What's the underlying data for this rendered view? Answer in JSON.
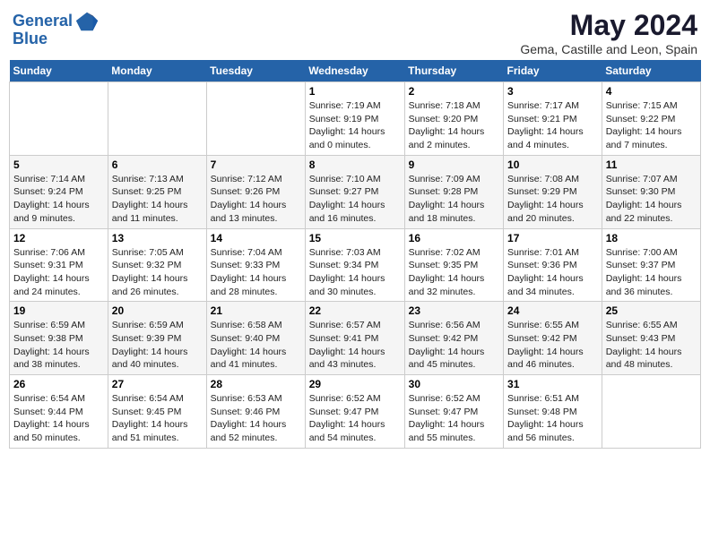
{
  "header": {
    "logo_line1": "General",
    "logo_line2": "Blue",
    "title": "May 2024",
    "subtitle": "Gema, Castille and Leon, Spain"
  },
  "days_of_week": [
    "Sunday",
    "Monday",
    "Tuesday",
    "Wednesday",
    "Thursday",
    "Friday",
    "Saturday"
  ],
  "weeks": [
    [
      {
        "day": "",
        "sunrise": "",
        "sunset": "",
        "daylight": ""
      },
      {
        "day": "",
        "sunrise": "",
        "sunset": "",
        "daylight": ""
      },
      {
        "day": "",
        "sunrise": "",
        "sunset": "",
        "daylight": ""
      },
      {
        "day": "1",
        "sunrise": "Sunrise: 7:19 AM",
        "sunset": "Sunset: 9:19 PM",
        "daylight": "Daylight: 14 hours and 0 minutes."
      },
      {
        "day": "2",
        "sunrise": "Sunrise: 7:18 AM",
        "sunset": "Sunset: 9:20 PM",
        "daylight": "Daylight: 14 hours and 2 minutes."
      },
      {
        "day": "3",
        "sunrise": "Sunrise: 7:17 AM",
        "sunset": "Sunset: 9:21 PM",
        "daylight": "Daylight: 14 hours and 4 minutes."
      },
      {
        "day": "4",
        "sunrise": "Sunrise: 7:15 AM",
        "sunset": "Sunset: 9:22 PM",
        "daylight": "Daylight: 14 hours and 7 minutes."
      }
    ],
    [
      {
        "day": "5",
        "sunrise": "Sunrise: 7:14 AM",
        "sunset": "Sunset: 9:24 PM",
        "daylight": "Daylight: 14 hours and 9 minutes."
      },
      {
        "day": "6",
        "sunrise": "Sunrise: 7:13 AM",
        "sunset": "Sunset: 9:25 PM",
        "daylight": "Daylight: 14 hours and 11 minutes."
      },
      {
        "day": "7",
        "sunrise": "Sunrise: 7:12 AM",
        "sunset": "Sunset: 9:26 PM",
        "daylight": "Daylight: 14 hours and 13 minutes."
      },
      {
        "day": "8",
        "sunrise": "Sunrise: 7:10 AM",
        "sunset": "Sunset: 9:27 PM",
        "daylight": "Daylight: 14 hours and 16 minutes."
      },
      {
        "day": "9",
        "sunrise": "Sunrise: 7:09 AM",
        "sunset": "Sunset: 9:28 PM",
        "daylight": "Daylight: 14 hours and 18 minutes."
      },
      {
        "day": "10",
        "sunrise": "Sunrise: 7:08 AM",
        "sunset": "Sunset: 9:29 PM",
        "daylight": "Daylight: 14 hours and 20 minutes."
      },
      {
        "day": "11",
        "sunrise": "Sunrise: 7:07 AM",
        "sunset": "Sunset: 9:30 PM",
        "daylight": "Daylight: 14 hours and 22 minutes."
      }
    ],
    [
      {
        "day": "12",
        "sunrise": "Sunrise: 7:06 AM",
        "sunset": "Sunset: 9:31 PM",
        "daylight": "Daylight: 14 hours and 24 minutes."
      },
      {
        "day": "13",
        "sunrise": "Sunrise: 7:05 AM",
        "sunset": "Sunset: 9:32 PM",
        "daylight": "Daylight: 14 hours and 26 minutes."
      },
      {
        "day": "14",
        "sunrise": "Sunrise: 7:04 AM",
        "sunset": "Sunset: 9:33 PM",
        "daylight": "Daylight: 14 hours and 28 minutes."
      },
      {
        "day": "15",
        "sunrise": "Sunrise: 7:03 AM",
        "sunset": "Sunset: 9:34 PM",
        "daylight": "Daylight: 14 hours and 30 minutes."
      },
      {
        "day": "16",
        "sunrise": "Sunrise: 7:02 AM",
        "sunset": "Sunset: 9:35 PM",
        "daylight": "Daylight: 14 hours and 32 minutes."
      },
      {
        "day": "17",
        "sunrise": "Sunrise: 7:01 AM",
        "sunset": "Sunset: 9:36 PM",
        "daylight": "Daylight: 14 hours and 34 minutes."
      },
      {
        "day": "18",
        "sunrise": "Sunrise: 7:00 AM",
        "sunset": "Sunset: 9:37 PM",
        "daylight": "Daylight: 14 hours and 36 minutes."
      }
    ],
    [
      {
        "day": "19",
        "sunrise": "Sunrise: 6:59 AM",
        "sunset": "Sunset: 9:38 PM",
        "daylight": "Daylight: 14 hours and 38 minutes."
      },
      {
        "day": "20",
        "sunrise": "Sunrise: 6:59 AM",
        "sunset": "Sunset: 9:39 PM",
        "daylight": "Daylight: 14 hours and 40 minutes."
      },
      {
        "day": "21",
        "sunrise": "Sunrise: 6:58 AM",
        "sunset": "Sunset: 9:40 PM",
        "daylight": "Daylight: 14 hours and 41 minutes."
      },
      {
        "day": "22",
        "sunrise": "Sunrise: 6:57 AM",
        "sunset": "Sunset: 9:41 PM",
        "daylight": "Daylight: 14 hours and 43 minutes."
      },
      {
        "day": "23",
        "sunrise": "Sunrise: 6:56 AM",
        "sunset": "Sunset: 9:42 PM",
        "daylight": "Daylight: 14 hours and 45 minutes."
      },
      {
        "day": "24",
        "sunrise": "Sunrise: 6:55 AM",
        "sunset": "Sunset: 9:42 PM",
        "daylight": "Daylight: 14 hours and 46 minutes."
      },
      {
        "day": "25",
        "sunrise": "Sunrise: 6:55 AM",
        "sunset": "Sunset: 9:43 PM",
        "daylight": "Daylight: 14 hours and 48 minutes."
      }
    ],
    [
      {
        "day": "26",
        "sunrise": "Sunrise: 6:54 AM",
        "sunset": "Sunset: 9:44 PM",
        "daylight": "Daylight: 14 hours and 50 minutes."
      },
      {
        "day": "27",
        "sunrise": "Sunrise: 6:54 AM",
        "sunset": "Sunset: 9:45 PM",
        "daylight": "Daylight: 14 hours and 51 minutes."
      },
      {
        "day": "28",
        "sunrise": "Sunrise: 6:53 AM",
        "sunset": "Sunset: 9:46 PM",
        "daylight": "Daylight: 14 hours and 52 minutes."
      },
      {
        "day": "29",
        "sunrise": "Sunrise: 6:52 AM",
        "sunset": "Sunset: 9:47 PM",
        "daylight": "Daylight: 14 hours and 54 minutes."
      },
      {
        "day": "30",
        "sunrise": "Sunrise: 6:52 AM",
        "sunset": "Sunset: 9:47 PM",
        "daylight": "Daylight: 14 hours and 55 minutes."
      },
      {
        "day": "31",
        "sunrise": "Sunrise: 6:51 AM",
        "sunset": "Sunset: 9:48 PM",
        "daylight": "Daylight: 14 hours and 56 minutes."
      },
      {
        "day": "",
        "sunrise": "",
        "sunset": "",
        "daylight": ""
      }
    ]
  ]
}
